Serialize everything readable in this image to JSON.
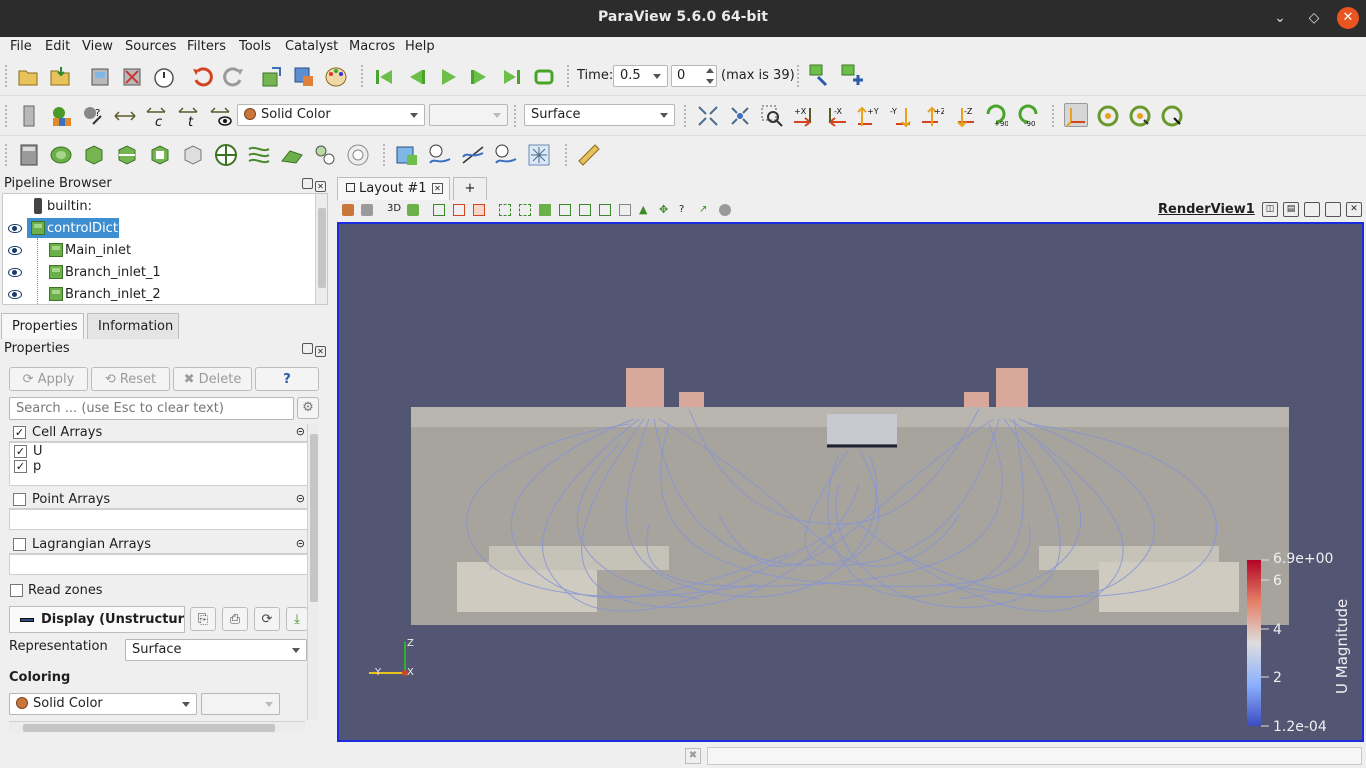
{
  "window": {
    "title": "ParaView 5.6.0 64-bit"
  },
  "menu": [
    "File",
    "Edit",
    "View",
    "Sources",
    "Filters",
    "Tools",
    "Catalyst",
    "Macros",
    "Help"
  ],
  "toolbar_time": {
    "label": "Time:",
    "value": "0.5",
    "index": "0",
    "max_text": "(max is 39)"
  },
  "toolbar_display": {
    "color_mode": "Solid Color",
    "component": "",
    "representation": "Surface"
  },
  "camera_buttons": [
    "+X",
    "-X",
    "+Y",
    "-Y",
    "+Z",
    "-Z",
    "+90",
    "-90"
  ],
  "pipeline": {
    "title": "Pipeline Browser",
    "server": "builtin:",
    "items": [
      {
        "label": "controlDict",
        "selected": true
      },
      {
        "label": "Main_inlet"
      },
      {
        "label": "Branch_inlet_1"
      },
      {
        "label": "Branch_inlet_2"
      }
    ]
  },
  "tabs": {
    "properties": "Properties",
    "information": "Information"
  },
  "properties": {
    "title": "Properties",
    "apply": "Apply",
    "reset": "Reset",
    "delete": "Delete",
    "help": "?",
    "search_placeholder": "Search ... (use Esc to clear text)",
    "cell_arrays": "Cell Arrays",
    "cell_items": [
      "U",
      "p"
    ],
    "point_arrays": "Point Arrays",
    "lagrangian_arrays": "Lagrangian Arrays",
    "read_zones": "Read zones",
    "display_section": "Display (Unstructur",
    "representation_label": "Representation",
    "representation_value": "Surface",
    "coloring_label": "Coloring",
    "coloring_value": "Solid Color"
  },
  "layout": {
    "tab": "Layout #1",
    "add": "+",
    "mode_3d": "3D",
    "view_name": "RenderView1"
  },
  "colorbar": {
    "title": "U Magnitude",
    "max": "6.9e+00",
    "min": "1.2e-04",
    "ticks": [
      "6",
      "4",
      "2"
    ]
  },
  "axes": {
    "z": "Z",
    "y": "Y",
    "x": "X"
  },
  "colors": {
    "background": "#525672",
    "accent": "#3d8fd1",
    "highlight_border": "#1a2be0"
  }
}
